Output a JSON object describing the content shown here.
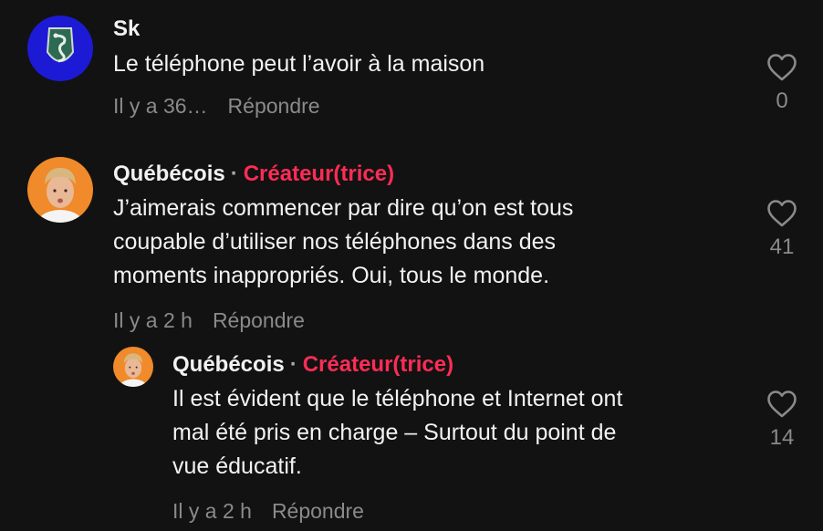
{
  "comments": [
    {
      "username": "Sk",
      "text": "Le téléphone peut l’avoir à la maison",
      "time": "Il y a 36…",
      "reply_label": "Répondre",
      "likes": "0",
      "avatar_icon": "serpent-crest-icon"
    },
    {
      "username": "Québécois",
      "separator": "·",
      "badge": "Créateur(trice)",
      "text": "J’aimerais commencer par dire qu’on est tous\ncoupable d’utiliser nos téléphones dans des\nmoments inappropriés. Oui, tous le monde.",
      "time": "Il y a 2 h",
      "reply_label": "Répondre",
      "likes": "41",
      "avatar_icon": "profile-photo"
    }
  ],
  "reply": {
    "username": "Québécois",
    "separator": "·",
    "badge": "Créateur(trice)",
    "text": "Il est évident que le téléphone et Internet ont\nmal été pris en charge – Surtout du point de\nvue éducatif.",
    "time": "Il y a 2 h",
    "reply_label": "Répondre",
    "likes": "14",
    "avatar_icon": "profile-photo"
  },
  "colors": {
    "background": "#121212",
    "creator_badge": "#fe2c55",
    "muted": "#8a8a8a"
  }
}
